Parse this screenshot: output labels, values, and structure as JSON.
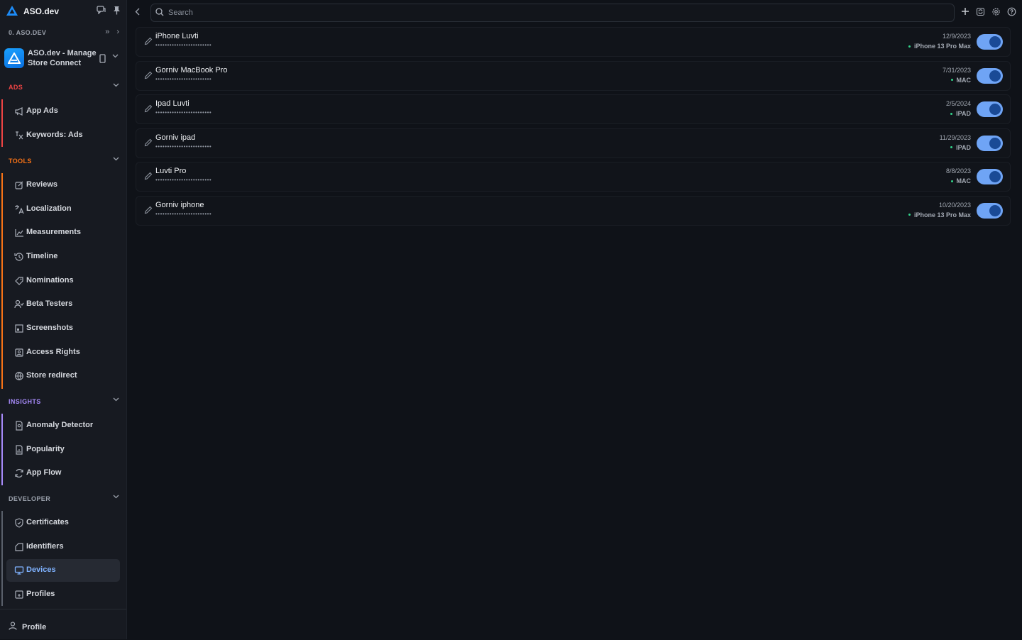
{
  "brand": {
    "name": "ASO.dev"
  },
  "workspace": {
    "name": "0. ASO.DEV"
  },
  "app": {
    "title": "ASO.dev - Manage Store Connect"
  },
  "colors": {
    "ads": "#ef4444",
    "tools": "#f97316",
    "insights": "#a78bfa",
    "developer": "#9aa0ab",
    "accent": "#7fb2ff",
    "toggle_on": "#6fa4f5"
  },
  "sections": {
    "ads": {
      "label": "ADS",
      "items": [
        {
          "label": "App Ads",
          "icon": "megaphone-icon"
        },
        {
          "label": "Keywords: Ads",
          "icon": "keywords-icon"
        }
      ]
    },
    "tools": {
      "label": "TOOLS",
      "items": [
        {
          "label": "Reviews",
          "icon": "reviews-icon"
        },
        {
          "label": "Localization",
          "icon": "translate-icon"
        },
        {
          "label": "Measurements",
          "icon": "chart-line-icon"
        },
        {
          "label": "Timeline",
          "icon": "history-icon"
        },
        {
          "label": "Nominations",
          "icon": "tag-icon"
        },
        {
          "label": "Beta Testers",
          "icon": "user-check-icon"
        },
        {
          "label": "Screenshots",
          "icon": "screenshots-icon"
        },
        {
          "label": "Access Rights",
          "icon": "access-icon"
        },
        {
          "label": "Store redirect",
          "icon": "globe-icon"
        }
      ]
    },
    "insights": {
      "label": "INSIGHTS",
      "items": [
        {
          "label": "Anomaly Detector",
          "icon": "doc-search-icon"
        },
        {
          "label": "Popularity",
          "icon": "doc-chart-icon"
        },
        {
          "label": "App Flow",
          "icon": "flow-icon"
        }
      ]
    },
    "developer": {
      "label": "DEVELOPER",
      "items": [
        {
          "label": "Certificates",
          "icon": "shield-icon"
        },
        {
          "label": "Identifiers",
          "icon": "tag-outline-icon"
        },
        {
          "label": "Devices",
          "icon": "monitor-icon"
        },
        {
          "label": "Profiles",
          "icon": "profile-doc-icon"
        }
      ]
    }
  },
  "footer": {
    "profile_label": "Profile"
  },
  "search": {
    "placeholder": "Search",
    "value": ""
  },
  "devices": [
    {
      "name": "iPhone Luvti",
      "masked": "••••••••••••••••••••••••",
      "date": "12/9/2023",
      "platform": "iPhone 13 Pro Max",
      "enabled": true
    },
    {
      "name": "Gorniv MacBook Pro",
      "masked": "••••••••••••••••••••••••",
      "date": "7/31/2023",
      "platform": "MAC",
      "enabled": true
    },
    {
      "name": "Ipad Luvti",
      "masked": "••••••••••••••••••••••••",
      "date": "2/5/2024",
      "platform": "IPAD",
      "enabled": true
    },
    {
      "name": "Gorniv ipad",
      "masked": "••••••••••••••••••••••••",
      "date": "11/29/2023",
      "platform": "IPAD",
      "enabled": true
    },
    {
      "name": "Luvti Pro",
      "masked": "••••••••••••••••••••••••",
      "date": "8/8/2023",
      "platform": "MAC",
      "enabled": true
    },
    {
      "name": "Gorniv iphone",
      "masked": "••••••••••••••••••••••••",
      "date": "10/20/2023",
      "platform": "iPhone 13 Pro Max",
      "enabled": true
    }
  ]
}
